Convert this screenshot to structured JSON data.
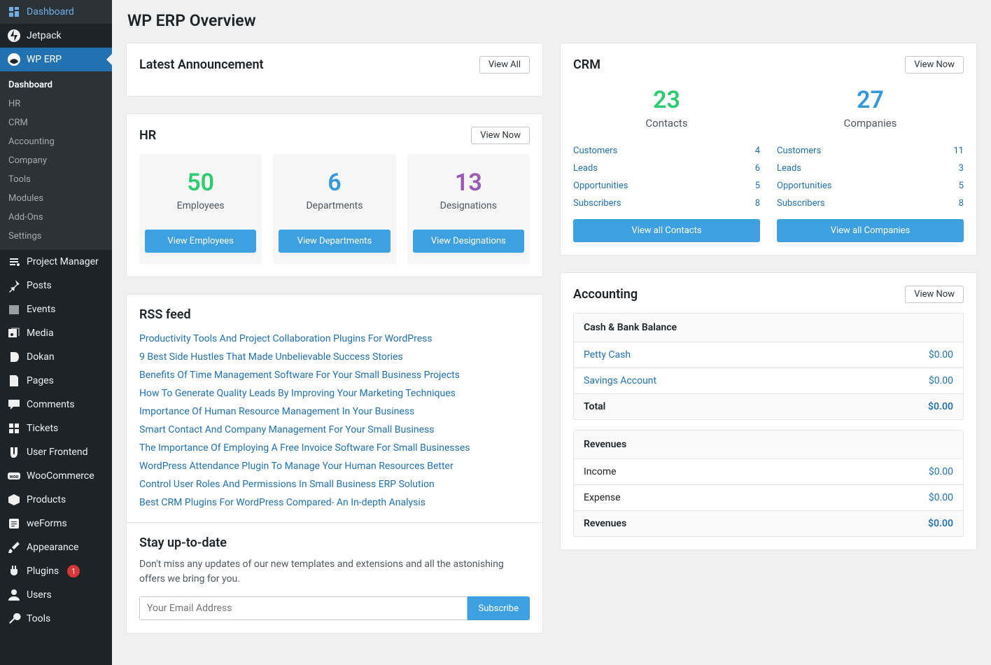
{
  "sidebar": {
    "main_items_top": [
      {
        "label": "Dashboard",
        "icon": "dashboard"
      },
      {
        "label": "Jetpack",
        "icon": "jetpack"
      }
    ],
    "wp_erp": {
      "label": "WP ERP",
      "icon": "erp"
    },
    "submenu": [
      {
        "label": "Dashboard",
        "current": true
      },
      {
        "label": "HR"
      },
      {
        "label": "CRM"
      },
      {
        "label": "Accounting"
      },
      {
        "label": "Company"
      },
      {
        "label": "Tools"
      },
      {
        "label": "Modules"
      },
      {
        "label": "Add-Ons"
      },
      {
        "label": "Settings"
      }
    ],
    "main_items_bottom": [
      {
        "label": "Project Manager",
        "icon": "pm"
      },
      {
        "label": "Posts",
        "icon": "pin"
      },
      {
        "label": "Events",
        "icon": "calendar"
      },
      {
        "label": "Media",
        "icon": "media"
      },
      {
        "label": "Dokan",
        "icon": "dokan"
      },
      {
        "label": "Pages",
        "icon": "page"
      },
      {
        "label": "Comments",
        "icon": "comment"
      },
      {
        "label": "Tickets",
        "icon": "ticket"
      },
      {
        "label": "User Frontend",
        "icon": "uf"
      },
      {
        "label": "WooCommerce",
        "icon": "woo"
      },
      {
        "label": "Products",
        "icon": "product"
      },
      {
        "label": "weForms",
        "icon": "forms"
      },
      {
        "label": "Appearance",
        "icon": "brush"
      },
      {
        "label": "Plugins",
        "icon": "plugin",
        "badge": "1"
      },
      {
        "label": "Users",
        "icon": "user"
      },
      {
        "label": "Tools",
        "icon": "wrench"
      }
    ]
  },
  "page": {
    "title": "WP ERP Overview"
  },
  "announcement": {
    "title": "Latest Announcement",
    "view_all": "View All"
  },
  "hr": {
    "title": "HR",
    "view_now": "View Now",
    "boxes": [
      {
        "value": "50",
        "label": "Employees",
        "btn": "View Employees",
        "color": "#2ecc71"
      },
      {
        "value": "6",
        "label": "Departments",
        "btn": "View Departments",
        "color": "#3498db"
      },
      {
        "value": "13",
        "label": "Designations",
        "btn": "View Designations",
        "color": "#9b59b6"
      }
    ]
  },
  "crm": {
    "title": "CRM",
    "view_now": "View Now",
    "columns": [
      {
        "big_value": "23",
        "big_label": "Contacts",
        "big_color": "#2ecc71",
        "rows": [
          {
            "label": "Customers",
            "value": "4"
          },
          {
            "label": "Leads",
            "value": "6"
          },
          {
            "label": "Opportunities",
            "value": "5"
          },
          {
            "label": "Subscribers",
            "value": "8"
          }
        ],
        "view_all": "View all Contacts"
      },
      {
        "big_value": "27",
        "big_label": "Companies",
        "big_color": "#3498db",
        "rows": [
          {
            "label": "Customers",
            "value": "11"
          },
          {
            "label": "Leads",
            "value": "3"
          },
          {
            "label": "Opportunities",
            "value": "5"
          },
          {
            "label": "Subscribers",
            "value": "8"
          }
        ],
        "view_all": "View all Companies"
      }
    ]
  },
  "rss": {
    "title": "RSS feed",
    "items": [
      "Productivity Tools And Project Collaboration Plugins For WordPress",
      "9 Best Side Hustles That Made Unbelievable Success Stories",
      "Benefits Of Time Management Software For Your Small Business Projects",
      "How To Generate Quality Leads By Improving Your Marketing Techniques",
      "Importance Of Human Resource Management In Your Business",
      "Smart Contact And Company Management For Your Small Business",
      "The Importance Of Employing A Free Invoice Software For Small Businesses",
      "WordPress Attendance Plugin To Manage Your Human Resources Better",
      "Control User Roles And Permissions In Small Business ERP Solution",
      "Best CRM Plugins For WordPress Compared- An In-depth Analysis"
    ],
    "subscribe": {
      "title": "Stay up-to-date",
      "desc": "Don't miss any updates of our new templates and extensions and all the astonishing offers we bring for you.",
      "placeholder": "Your Email Address",
      "btn": "Subscribe"
    }
  },
  "accounting": {
    "title": "Accounting",
    "view_now": "View Now",
    "blocks": [
      {
        "heading": "Cash & Bank Balance",
        "rows": [
          {
            "label": "Petty Cash",
            "amount": "$0.00",
            "link": true
          },
          {
            "label": "Savings Account",
            "amount": "$0.00",
            "link": true
          }
        ],
        "total": {
          "label": "Total",
          "amount": "$0.00"
        }
      },
      {
        "heading": "Revenues",
        "rows": [
          {
            "label": "Income",
            "amount": "$0.00",
            "link": false
          },
          {
            "label": "Expense",
            "amount": "$0.00",
            "link": false
          }
        ],
        "total": {
          "label": "Revenues",
          "amount": "$0.00"
        }
      }
    ]
  }
}
